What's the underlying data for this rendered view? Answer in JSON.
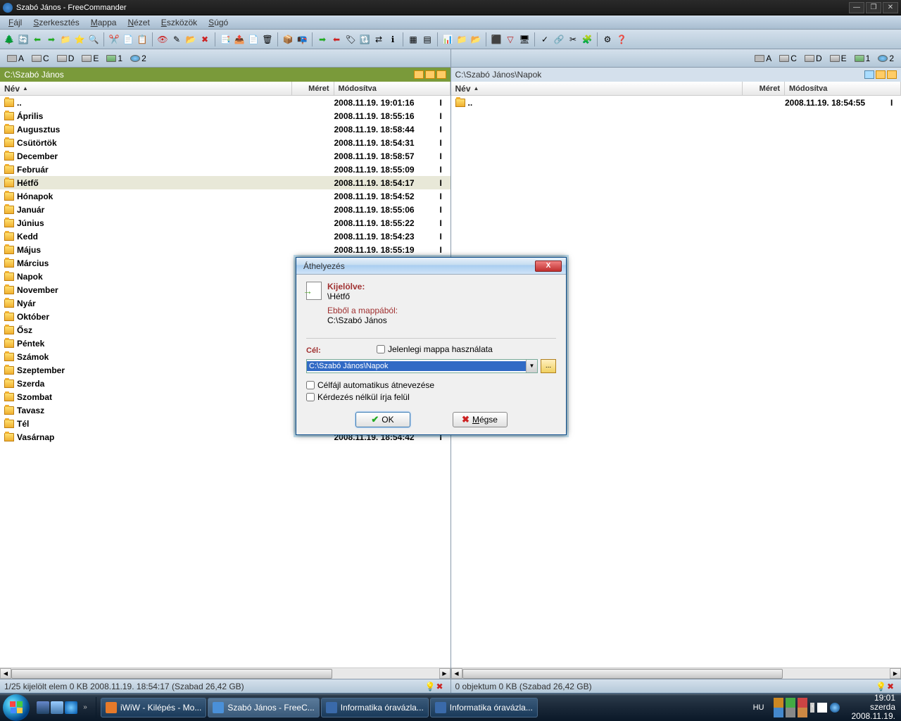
{
  "window": {
    "title": "Szabó János - FreeCommander"
  },
  "menu": [
    "Fájl",
    "Szerkesztés",
    "Mappa",
    "Nézet",
    "Eszközök",
    "Súgó"
  ],
  "drives": [
    {
      "label": "A"
    },
    {
      "label": "C"
    },
    {
      "label": "D"
    },
    {
      "label": "E"
    },
    {
      "label": "1"
    },
    {
      "label": "2"
    }
  ],
  "left": {
    "path": "C:\\Szabó János",
    "cols": {
      "name": "Név",
      "size": "Méret",
      "date": "Módosítva"
    },
    "files": [
      {
        "name": "..",
        "date": "2008.11.19. 19:01:16"
      },
      {
        "name": "Április",
        "date": "2008.11.19. 18:55:16"
      },
      {
        "name": "Augusztus",
        "date": "2008.11.19. 18:58:44"
      },
      {
        "name": "Csütörtök",
        "date": "2008.11.19. 18:54:31"
      },
      {
        "name": "December",
        "date": "2008.11.19. 18:58:57"
      },
      {
        "name": "Február",
        "date": "2008.11.19. 18:55:09"
      },
      {
        "name": "Hétfő",
        "date": "2008.11.19. 18:54:17",
        "selected": true
      },
      {
        "name": "Hónapok",
        "date": "2008.11.19. 18:54:52"
      },
      {
        "name": "Január",
        "date": "2008.11.19. 18:55:06"
      },
      {
        "name": "Június",
        "date": "2008.11.19. 18:55:22"
      },
      {
        "name": "Kedd",
        "date": "2008.11.19. 18:54:23"
      },
      {
        "name": "Május",
        "date": "2008.11.19. 18:55:19"
      },
      {
        "name": "Március",
        "date": ""
      },
      {
        "name": "Napok",
        "date": ""
      },
      {
        "name": "November",
        "date": ""
      },
      {
        "name": "Nyár",
        "date": ""
      },
      {
        "name": "Október",
        "date": ""
      },
      {
        "name": "Ősz",
        "date": ""
      },
      {
        "name": "Péntek",
        "date": ""
      },
      {
        "name": "Számok",
        "date": ""
      },
      {
        "name": "Szeptember",
        "date": ""
      },
      {
        "name": "Szerda",
        "date": ""
      },
      {
        "name": "Szombat",
        "date": ""
      },
      {
        "name": "Tavasz",
        "date": ""
      },
      {
        "name": "Tél",
        "date": ""
      },
      {
        "name": "Vasárnap",
        "date": "2008.11.19. 18:54:42"
      }
    ],
    "status": "1/25 kijelölt elem   0 KB   2008.11.19. 18:54:17     (Szabad 26,42 GB)"
  },
  "right": {
    "path": "C:\\Szabó János\\Napok",
    "cols": {
      "name": "Név",
      "size": "Méret",
      "date": "Módosítva"
    },
    "files": [
      {
        "name": "..",
        "date": "2008.11.19. 18:54:55"
      }
    ],
    "status": "0 objektum   0 KB     (Szabad 26,42 GB)"
  },
  "dialog": {
    "title": "Áthelyezés",
    "selected_label": "Kijelölve:",
    "selected_value": "\\Hétfő",
    "from_label": "Ebből a mappából:",
    "from_value": "C:\\Szabó János",
    "target_label": "Cél:",
    "use_current": "Jelenlegi mappa használata",
    "target_path": "C:\\Szabó János\\Napok",
    "auto_rename": "Célfájl automatikus átnevezése",
    "overwrite": "Kérdezés nélkül írja felül",
    "ok": "OK",
    "cancel": "Mégse"
  },
  "taskbar": {
    "items": [
      {
        "label": "iWiW - Kilépés - Mo...",
        "color": "#e67a2a"
      },
      {
        "label": "Szabó János - FreeC...",
        "color": "#4a90d9",
        "active": true
      },
      {
        "label": "Informatika óravázla...",
        "color": "#3a6aaa"
      },
      {
        "label": "Informatika óravázla...",
        "color": "#3a6aaa"
      }
    ],
    "lang": "HU",
    "time": "19:01",
    "day": "szerda",
    "date": "2008.11.19."
  }
}
